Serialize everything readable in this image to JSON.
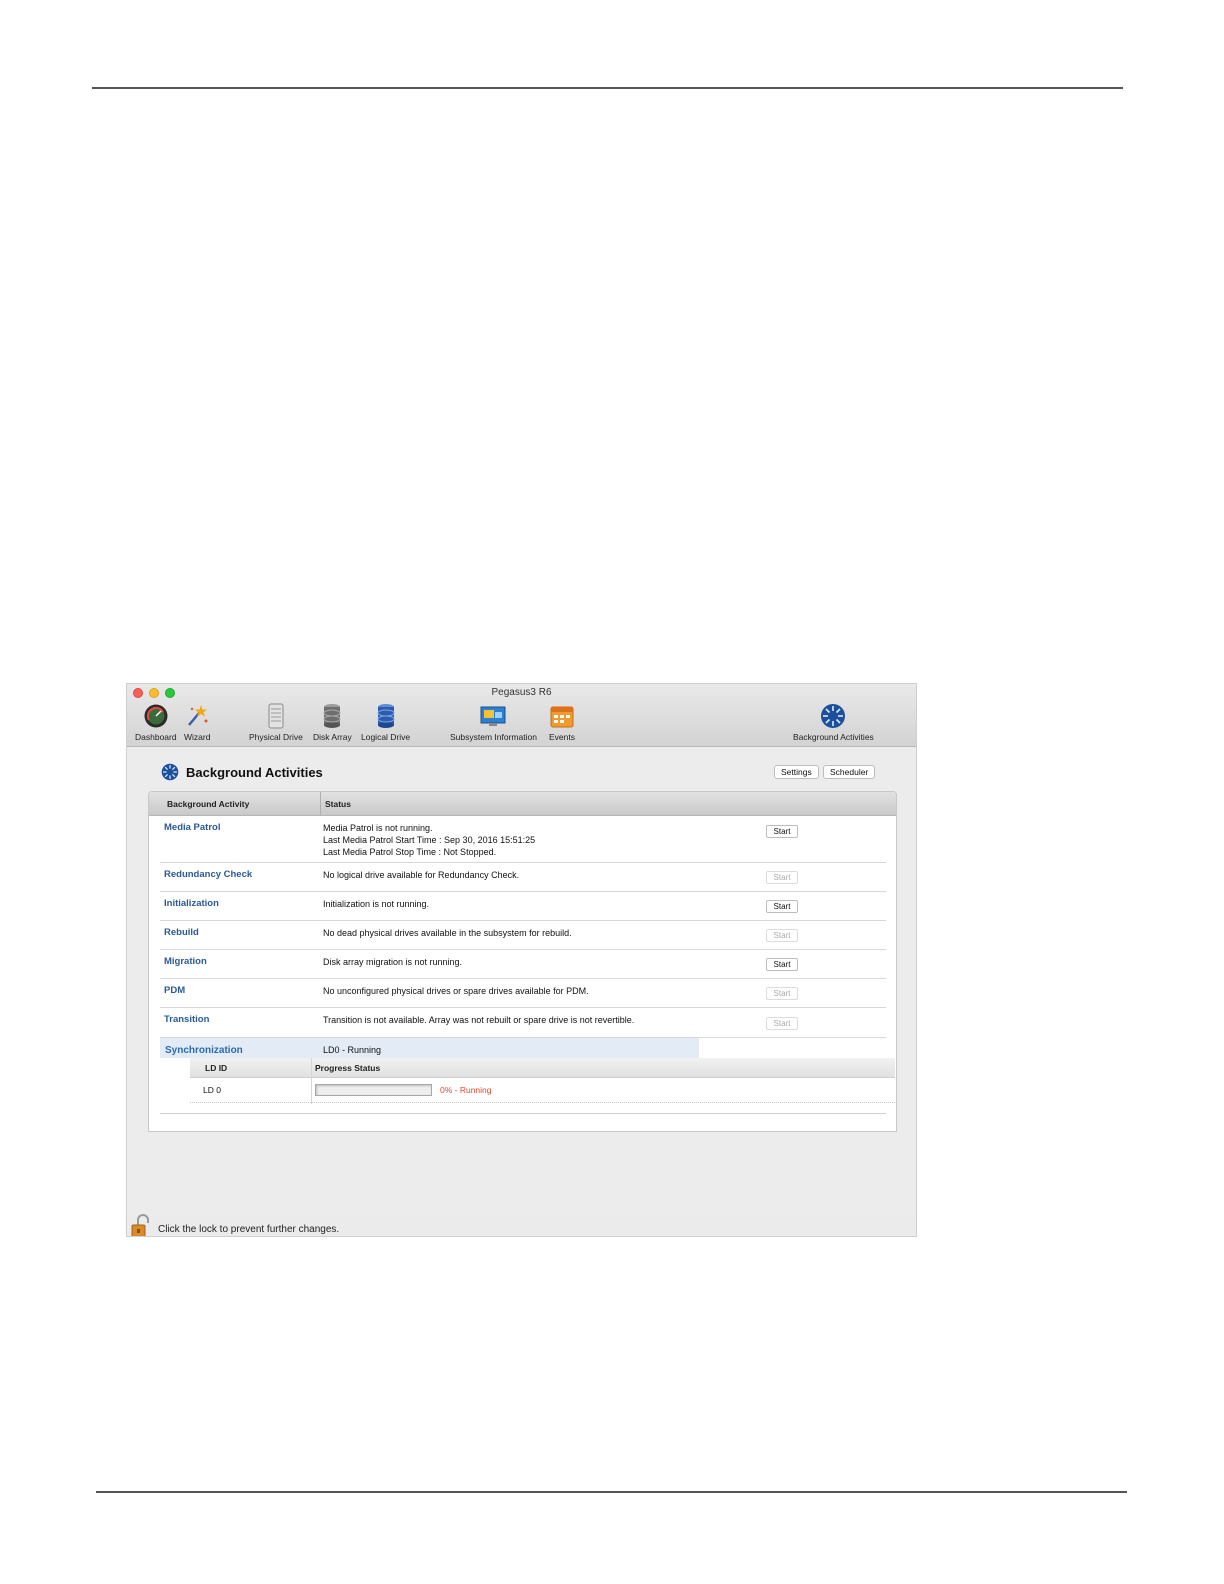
{
  "window": {
    "title": "Pegasus3 R6"
  },
  "toolbar": {
    "items": [
      {
        "label": "Dashboard",
        "icon": "dashboard-icon"
      },
      {
        "label": "Wizard",
        "icon": "wizard-icon"
      },
      {
        "label": "Physical Drive",
        "icon": "physical-drive-icon"
      },
      {
        "label": "Disk Array",
        "icon": "disk-array-icon"
      },
      {
        "label": "Logical Drive",
        "icon": "logical-drive-icon"
      },
      {
        "label": "Subsystem Information",
        "icon": "subsystem-information-icon"
      },
      {
        "label": "Events",
        "icon": "events-icon"
      },
      {
        "label": "Background Activities",
        "icon": "background-activities-icon"
      }
    ]
  },
  "page": {
    "title": "Background Activities",
    "settings_label": "Settings",
    "scheduler_label": "Scheduler"
  },
  "table": {
    "headers": {
      "activity": "Background Activity",
      "status": "Status"
    },
    "rows": [
      {
        "name": "Media Patrol",
        "status": [
          "Media Patrol is not running.",
          "Last Media Patrol Start Time : Sep 30, 2016 15:51:25",
          "Last Media Patrol Stop Time : Not Stopped."
        ],
        "button": "Start",
        "enabled": true
      },
      {
        "name": "Redundancy Check",
        "status": [
          "No logical drive available for Redundancy Check."
        ],
        "button": "Start",
        "enabled": false
      },
      {
        "name": "Initialization",
        "status": [
          "Initialization is not running."
        ],
        "button": "Start",
        "enabled": true
      },
      {
        "name": "Rebuild",
        "status": [
          "No dead physical drives available in the subsystem for rebuild."
        ],
        "button": "Start",
        "enabled": false
      },
      {
        "name": "Migration",
        "status": [
          "Disk array migration is not running."
        ],
        "button": "Start",
        "enabled": true
      },
      {
        "name": "PDM",
        "status": [
          "No unconfigured physical drives or spare drives available for PDM."
        ],
        "button": "Start",
        "enabled": false
      },
      {
        "name": "Transition",
        "status": [
          "Transition is not available. Array was not rebuilt or spare drive is not revertible."
        ],
        "button": "Start",
        "enabled": false
      }
    ],
    "synchronization": {
      "name": "Synchronization",
      "status": "LD0 - Running",
      "sub_headers": {
        "ld_id": "LD ID",
        "progress": "Progress Status"
      },
      "entries": [
        {
          "ld": "LD 0",
          "progress_text": "0% - Running",
          "progress_percent": 0
        }
      ]
    }
  },
  "footer": {
    "lock_text": "Click the lock to prevent further changes."
  },
  "colors": {
    "link": "#2a5a96",
    "progress_text": "#e0482a"
  }
}
